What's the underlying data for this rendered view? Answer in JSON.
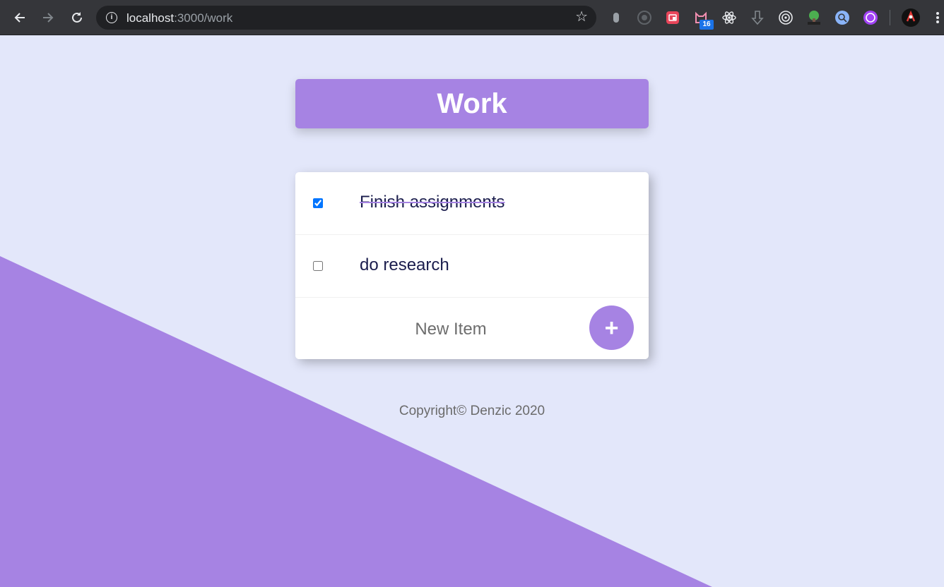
{
  "browser": {
    "url_host": "localhost",
    "url_path": ":3000/work",
    "extension_badge": "16"
  },
  "colors": {
    "accent": "#a683e3",
    "background": "#e3e7fa",
    "text": "#1b1d4d"
  },
  "page": {
    "title": "Work",
    "items": [
      {
        "label": "Finish assignments",
        "checked": true
      },
      {
        "label": "do research",
        "checked": false
      }
    ],
    "new_item_placeholder": "New Item",
    "add_button_label": "+",
    "footer": "Copyright© Denzic 2020"
  }
}
